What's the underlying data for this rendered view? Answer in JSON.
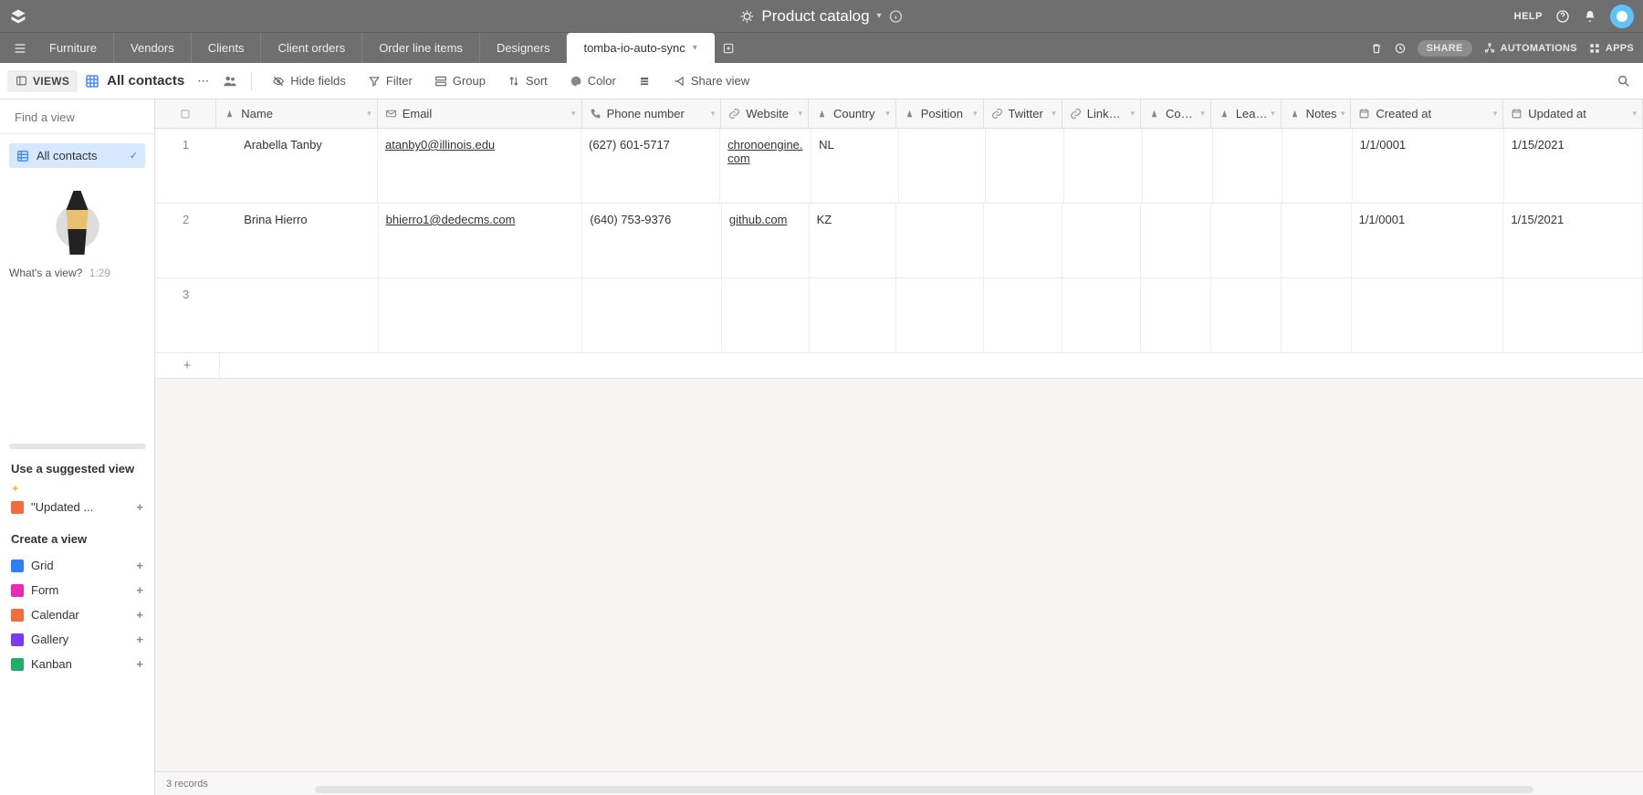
{
  "topbar": {
    "title": "Product catalog",
    "help_label": "HELP"
  },
  "tabs": {
    "items": [
      "Furniture",
      "Vendors",
      "Clients",
      "Client orders",
      "Order line items",
      "Designers",
      "tomba-io-auto-sync"
    ],
    "active_index": 6
  },
  "tools": {
    "share": "SHARE",
    "automations": "AUTOMATIONS",
    "apps": "APPS"
  },
  "viewbar": {
    "views_btn": "VIEWS",
    "view_name": "All contacts",
    "hide_fields": "Hide fields",
    "filter": "Filter",
    "group": "Group",
    "sort": "Sort",
    "color": "Color",
    "share_view": "Share view"
  },
  "sidebar": {
    "find_placeholder": "Find a view",
    "current_view": "All contacts",
    "promo_text": "What's a view?",
    "promo_time": "1:29",
    "suggested_title": "Use a suggested view",
    "suggested_item": "\"Updated ...",
    "create_title": "Create a view",
    "create_items": [
      "Grid",
      "Form",
      "Calendar",
      "Gallery",
      "Kanban"
    ]
  },
  "columns": [
    "Name",
    "Email",
    "Phone number",
    "Website",
    "Country",
    "Position",
    "Twitter",
    "Link…",
    "Co…",
    "Lea…",
    "Notes",
    "Created at",
    "Updated at"
  ],
  "rows": [
    {
      "num": "1",
      "name": "Arabella Tanby",
      "email": "atanby0@illinois.edu",
      "phone": "(627) 601-5717",
      "website": "chronoengine.com",
      "country": "NL",
      "position": "",
      "twitter": "",
      "linkedin": "",
      "company": "",
      "lead": "",
      "notes": "",
      "created": "1/1/0001",
      "updated": "1/15/2021"
    },
    {
      "num": "2",
      "name": "Brina Hierro",
      "email": "bhierro1@dedecms.com",
      "phone": "(640) 753-9376",
      "website": "github.com",
      "country": "KZ",
      "position": "",
      "twitter": "",
      "linkedin": "",
      "company": "",
      "lead": "",
      "notes": "",
      "created": "1/1/0001",
      "updated": "1/15/2021"
    },
    {
      "num": "3",
      "name": "",
      "email": "",
      "phone": "",
      "website": "",
      "country": "",
      "position": "",
      "twitter": "",
      "linkedin": "",
      "company": "",
      "lead": "",
      "notes": "",
      "created": "",
      "updated": ""
    }
  ],
  "footer": {
    "record_count": "3 records"
  }
}
